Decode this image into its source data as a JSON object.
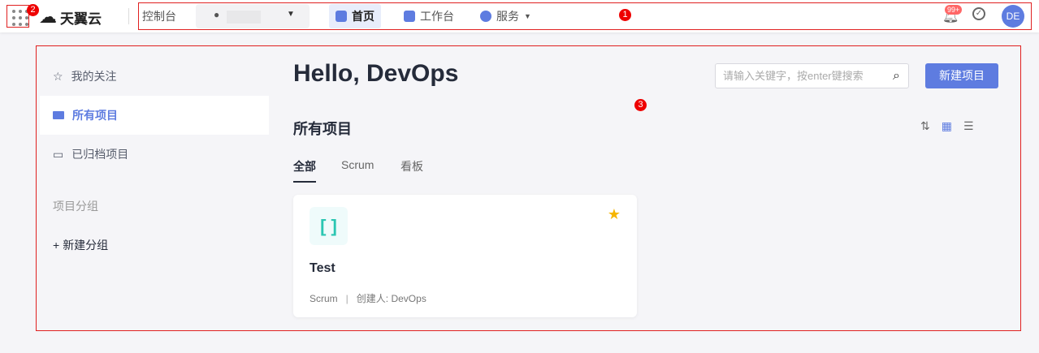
{
  "markers": [
    "1",
    "2",
    "3"
  ],
  "header": {
    "brand": "天翼云",
    "console": "控制台",
    "nav": [
      {
        "label": "首页"
      },
      {
        "label": "工作台"
      },
      {
        "label": "服务"
      }
    ],
    "badge": "99+",
    "avatar": "DE"
  },
  "sidebar": {
    "items": [
      {
        "label": "我的关注"
      },
      {
        "label": "所有项目"
      },
      {
        "label": "已归档项目"
      }
    ],
    "group_title": "项目分组",
    "new_group": "新建分组"
  },
  "main": {
    "greeting": "Hello, DevOps",
    "search_placeholder": "请输入关键字，按enter键搜索",
    "new_project": "新建项目",
    "section_title": "所有项目",
    "tabs": [
      {
        "label": "全部"
      },
      {
        "label": "Scrum"
      },
      {
        "label": "看板"
      }
    ],
    "projects": [
      {
        "name": "Test",
        "type": "Scrum",
        "creator": "创建人: DevOps"
      }
    ]
  }
}
